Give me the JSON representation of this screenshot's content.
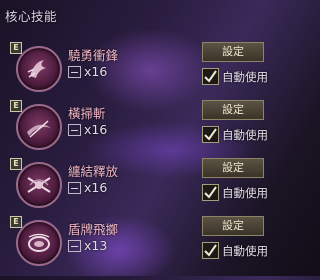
{
  "panel": {
    "title": "核心技能"
  },
  "skills": [
    {
      "rank": "E",
      "name": "驍勇衝鋒",
      "count_icon_label": "数量",
      "count": "x16",
      "set_label": "設定",
      "auto_label": "自動使用",
      "auto_checked": true,
      "icon": "charge-icon"
    },
    {
      "rank": "E",
      "name": "橫掃斬",
      "count_icon_label": "数量",
      "count": "x16",
      "set_label": "設定",
      "auto_label": "自動使用",
      "auto_checked": true,
      "icon": "sweep-slash-icon"
    },
    {
      "rank": "E",
      "name": "纏結釋放",
      "count_icon_label": "数量",
      "count": "x16",
      "set_label": "設定",
      "auto_label": "自動使用",
      "auto_checked": true,
      "icon": "tangle-release-icon"
    },
    {
      "rank": "E",
      "name": "盾牌飛擲",
      "count_icon_label": "数量",
      "count": "x13",
      "set_label": "設定",
      "auto_label": "自動使用",
      "auto_checked": true,
      "icon": "shield-throw-icon"
    }
  ]
}
